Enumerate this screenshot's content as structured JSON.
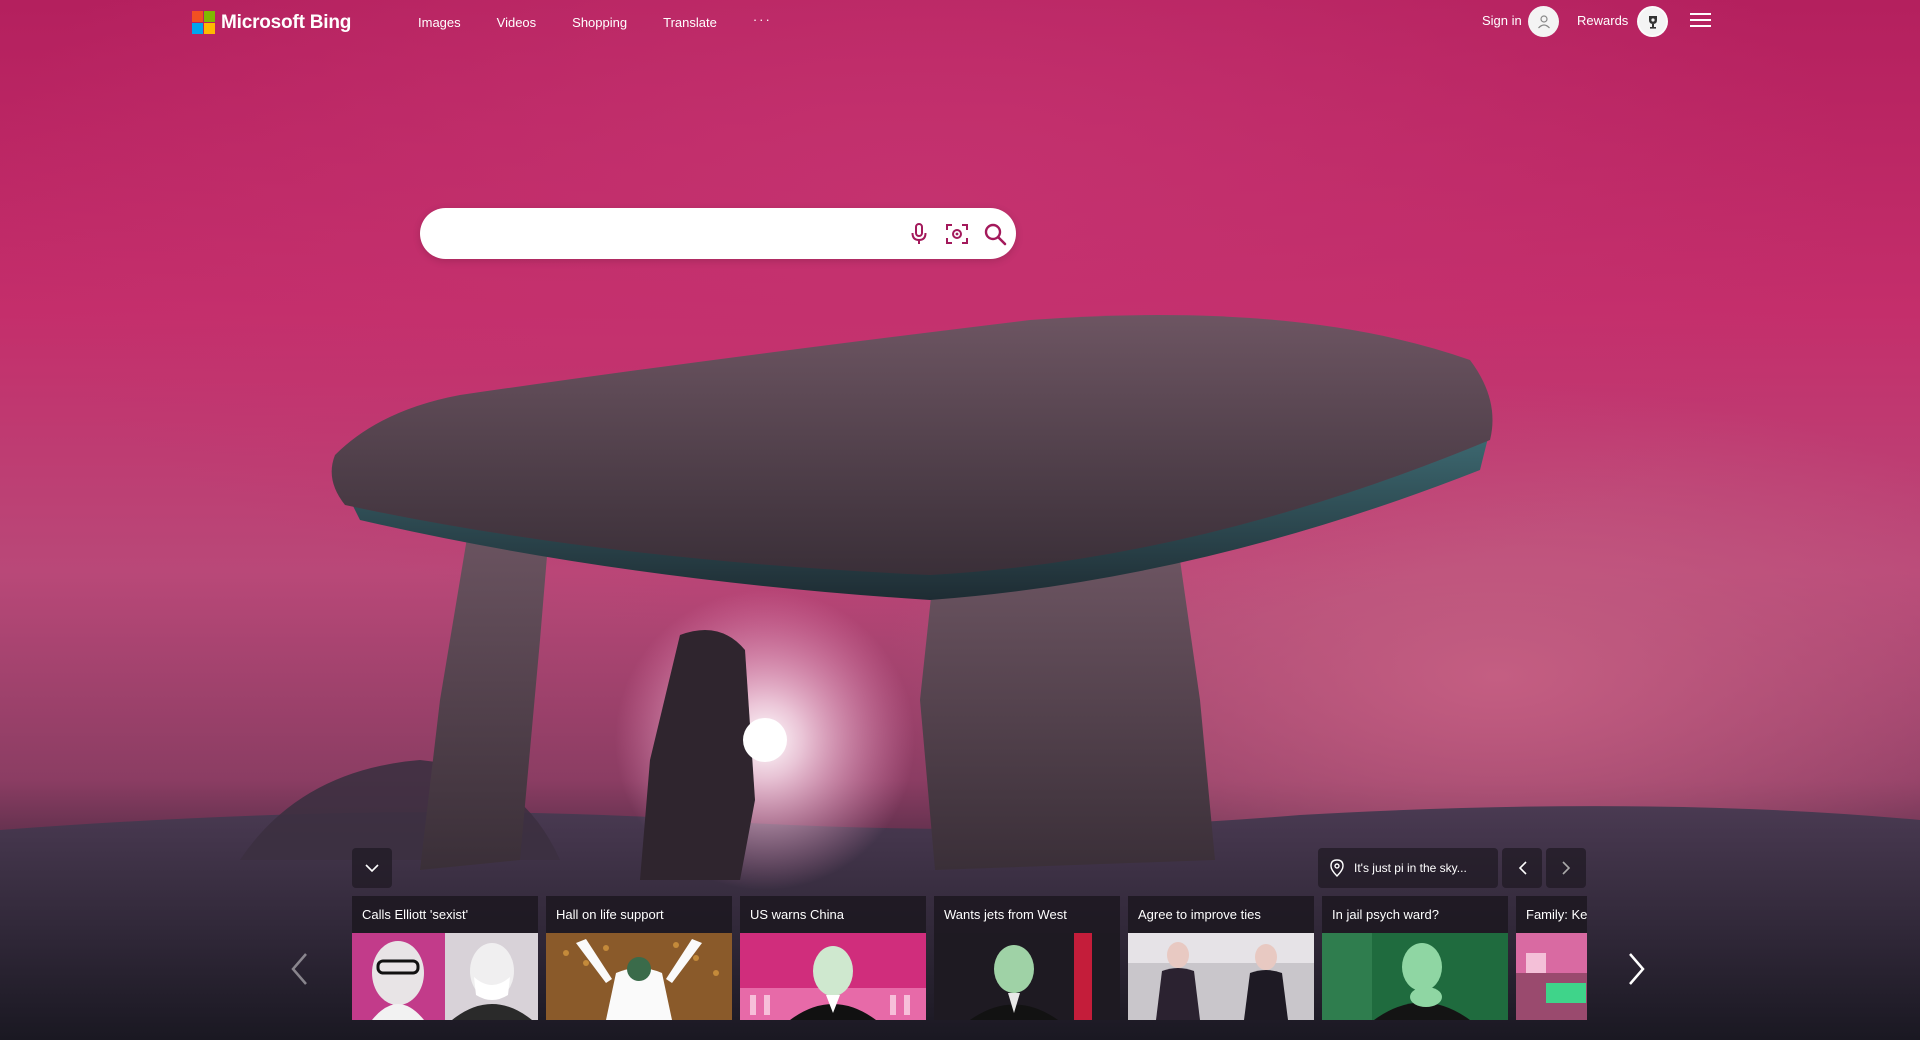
{
  "header": {
    "logo_text": "Microsoft Bing",
    "logo_colors": [
      "#f25022",
      "#7fba00",
      "#00a4ef",
      "#ffb900"
    ],
    "nav": [
      {
        "label": "Images"
      },
      {
        "label": "Videos"
      },
      {
        "label": "Shopping"
      },
      {
        "label": "Translate"
      }
    ],
    "more_label": "···",
    "signin_label": "Sign in",
    "avatar_icon": "user-icon",
    "rewards_label": "Rewards",
    "rewards_icon": "trophy-icon",
    "menu_icon": "hamburger-icon"
  },
  "search": {
    "value": "",
    "placeholder": "",
    "icons": [
      "microphone-icon",
      "visual-search-icon",
      "search-icon"
    ],
    "accent": "#a3195b"
  },
  "news": {
    "location_text": "It's just pi in the sky...",
    "cards": [
      {
        "title": "Calls Elliott 'sexist'"
      },
      {
        "title": "Hall on life support"
      },
      {
        "title": "US warns China"
      },
      {
        "title": "Wants jets from West"
      },
      {
        "title": "Agree to improve ties"
      },
      {
        "title": "In jail psych ward?"
      },
      {
        "title": "Family: Ke"
      }
    ]
  }
}
